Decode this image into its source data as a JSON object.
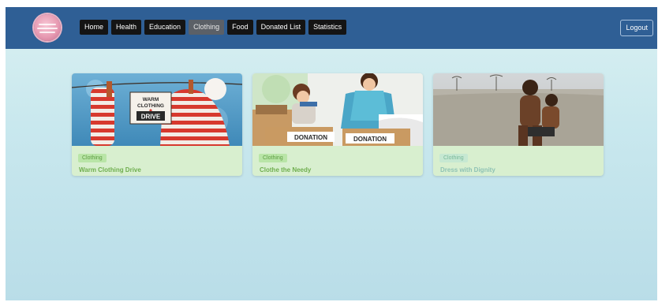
{
  "nav": {
    "items": [
      {
        "label": "Home",
        "active": false
      },
      {
        "label": "Health",
        "active": false
      },
      {
        "label": "Education",
        "active": false
      },
      {
        "label": "Clothing",
        "active": true
      },
      {
        "label": "Food",
        "active": false
      },
      {
        "label": "Donated List",
        "active": false
      },
      {
        "label": "Statistics",
        "active": false
      }
    ],
    "logout_label": "Logout"
  },
  "cards": [
    {
      "category": "Clothing",
      "title": "Warm Clothing Drive",
      "sign_lines": [
        "WARM",
        "CLOTHING",
        "DRIVE"
      ]
    },
    {
      "category": "Clothing",
      "title": "Clothe the Needy",
      "box_labels": [
        "DONATION",
        "DONATION"
      ]
    },
    {
      "category": "Clothing",
      "title": "Dress with Dignity"
    }
  ],
  "colors": {
    "navbar": "#2f5f95",
    "active_tab": "#5b6067",
    "card_background": "#d8efcf",
    "badge_text": "#5d9d42"
  }
}
